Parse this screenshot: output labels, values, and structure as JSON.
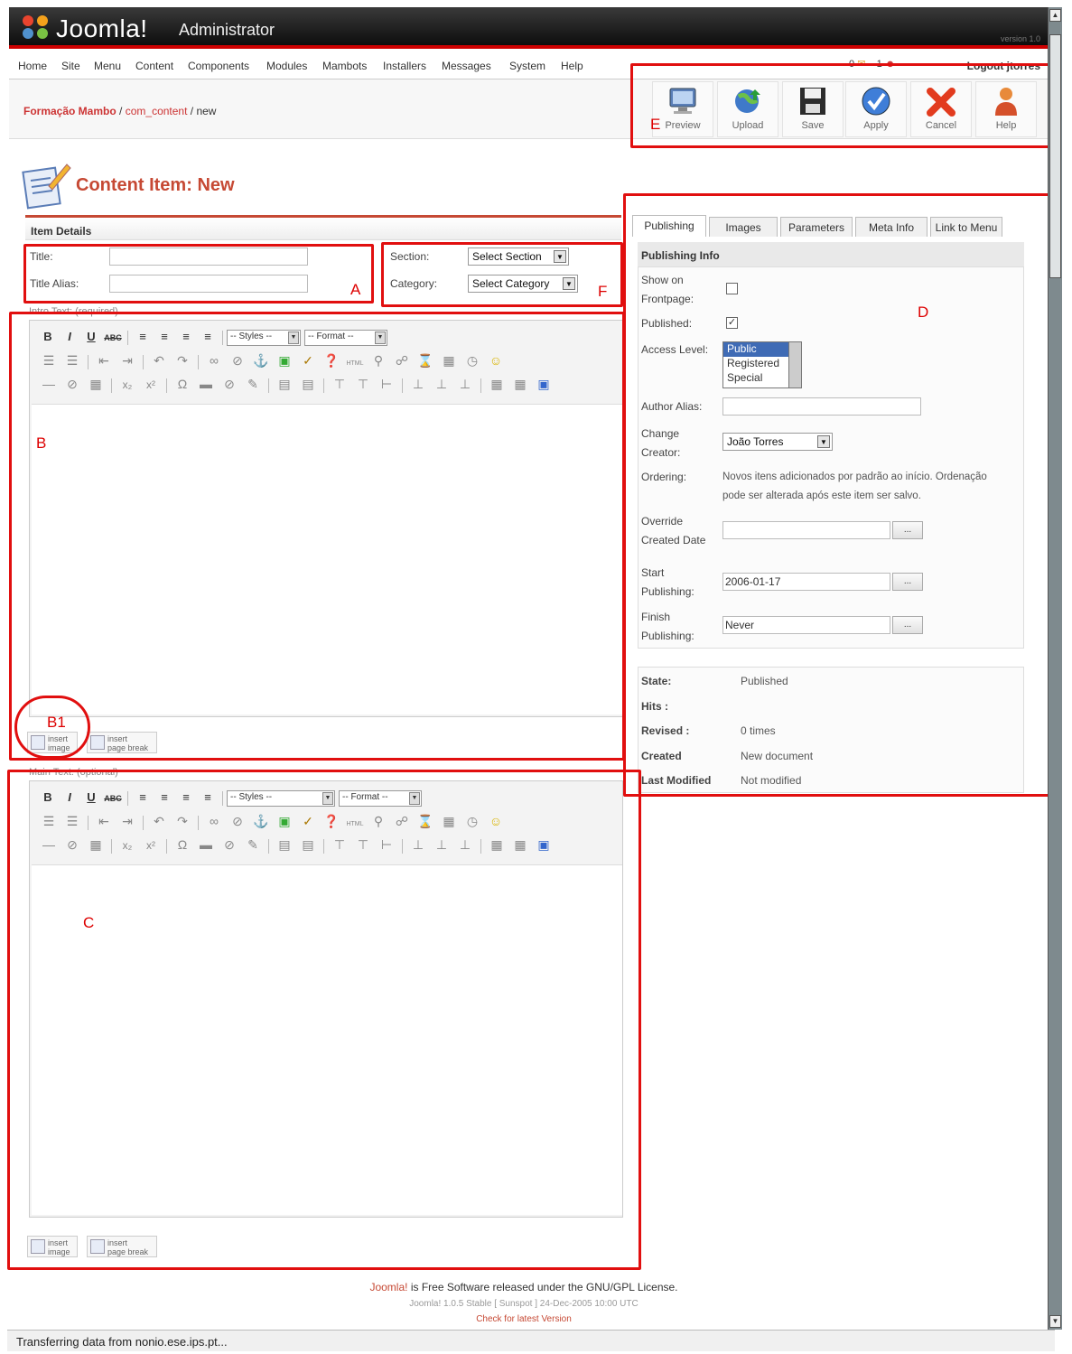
{
  "header": {
    "logo_text": "Joomla!",
    "admin_text": "Administrator",
    "version": "version 1.0"
  },
  "menu": {
    "items": [
      "Home",
      "Site",
      "Menu",
      "Content",
      "Components",
      "Modules",
      "Mambots",
      "Installers",
      "Messages",
      "System",
      "Help"
    ],
    "messages_count": "0",
    "users_count": "1",
    "logout": "Logout jtorres"
  },
  "breadcrumb": {
    "site": "Formação Mambo",
    "component": "com_content",
    "page": "/ new"
  },
  "toolbar": {
    "preview": "Preview",
    "upload": "Upload",
    "save": "Save",
    "apply": "Apply",
    "cancel": "Cancel",
    "help": "Help"
  },
  "page": {
    "title": "Content Item:",
    "title_state": "New"
  },
  "item_details": {
    "heading": "Item Details",
    "title_label": "Title:",
    "title_value": "",
    "alias_label": "Title Alias:",
    "alias_value": "",
    "section_label": "Section:",
    "section_value": "Select Section",
    "category_label": "Category:",
    "category_value": "Select Category"
  },
  "editors": {
    "intro_label": "Intro Text: (required)",
    "main_label": "Main Text: (optional)",
    "styles": "-- Styles --",
    "format": "-- Format --",
    "insert_image_1": "insert",
    "insert_image_2": "image",
    "insert_break_1": "insert",
    "insert_break_2": "page break"
  },
  "tabs": [
    "Publishing",
    "Images",
    "Parameters",
    "Meta Info",
    "Link to Menu"
  ],
  "publishing": {
    "heading": "Publishing Info",
    "show_frontpage_1": "Show on",
    "show_frontpage_2": "Frontpage:",
    "published_label": "Published:",
    "published_mark": "✓",
    "access_label": "Access Level:",
    "access_options": [
      "Public",
      "Registered",
      "Special"
    ],
    "author_alias_label": "Author Alias:",
    "change_creator_1": "Change",
    "change_creator_2": "Creator:",
    "creator_value": "João Torres",
    "ordering_label": "Ordering:",
    "ordering_text_1": "Novos itens adicionados por padrão ao início. Ordenação",
    "ordering_text_2": "pode ser alterada após este item ser salvo.",
    "override_1": "Override",
    "override_2": "Created Date",
    "start_1": "Start",
    "start_2": "Publishing:",
    "start_value": "2006-01-17",
    "finish_1": "Finish",
    "finish_2": "Publishing:",
    "finish_value": "Never",
    "dots": "..."
  },
  "status": {
    "state_label": "State:",
    "state_value": "Published",
    "hits_label": "Hits :",
    "hits_value": "",
    "revised_label": "Revised :",
    "revised_value": "0 times",
    "created_label": "Created",
    "created_value": "New document",
    "modified_label": "Last Modified",
    "modified_value": "Not modified"
  },
  "annotations": {
    "a": "A",
    "b": "B",
    "b1": "B1",
    "c": "C",
    "d": "D",
    "e": "E",
    "f": "F"
  },
  "footer": {
    "joomla": "Joomla!",
    "license": " is Free Software released under the GNU/GPL License.",
    "version": "Joomla! 1.0.5 Stable [ Sunspot ] 24-Dec-2005 10:00 UTC",
    "check": "Check for latest Version"
  },
  "statusbar": "Transferring data from nonio.ese.ips.pt..."
}
